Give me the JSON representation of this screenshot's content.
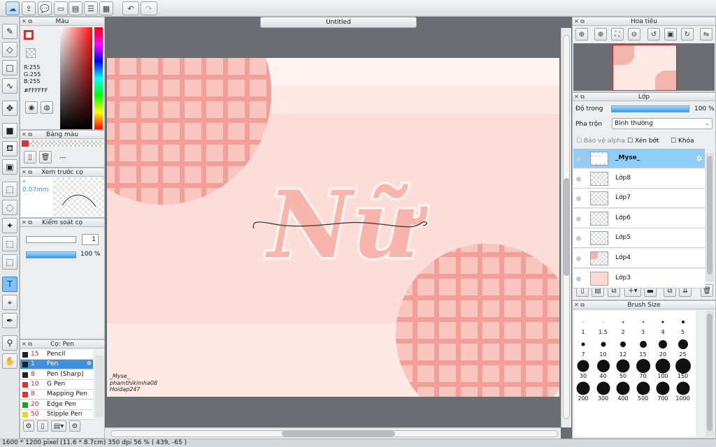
{
  "document": {
    "tab_title": "Untitled"
  },
  "panels": {
    "color": {
      "title": "Màu",
      "r": "R:255",
      "g": "G:255",
      "b": "B:255",
      "hex": "#FFFFFF"
    },
    "palette": {
      "title": "Bảng màu",
      "placeholder": "---"
    },
    "brush_preview": {
      "title": "Xem trước cọ",
      "size": "* 0.07mm"
    },
    "brush_control": {
      "title": "Kiểm soát cọ",
      "size_value": "1",
      "opacity": "100 %"
    },
    "brush_list": {
      "title": "Cọ: Pen",
      "items": [
        {
          "size": "15",
          "name": "Pencil",
          "color": "#222222"
        },
        {
          "size": "1",
          "name": "Pen",
          "color": "#222222"
        },
        {
          "size": "8",
          "name": "Pen (Sharp)",
          "color": "#222222"
        },
        {
          "size": "10",
          "name": "G Pen",
          "color": "#e23030"
        },
        {
          "size": "8",
          "name": "Mapping Pen",
          "color": "#e23030"
        },
        {
          "size": "20",
          "name": "Edge Pen",
          "color": "#22a022"
        },
        {
          "size": "50",
          "name": "Stipple Pen",
          "color": "#e8d820"
        }
      ]
    },
    "navigator": {
      "title": "Hoa tiêu"
    },
    "layers": {
      "title": "Lớp",
      "opacity_label": "Độ trong",
      "opacity_value": "100 %",
      "blend_label": "Pha trộn",
      "blend_value": "Bình thường",
      "protect_alpha": "Bảo vệ alpha",
      "clipping": "Xén bớt",
      "lock": "Khóa",
      "items": [
        {
          "name": "_Myse_",
          "selected": true
        },
        {
          "name": "Lớp8"
        },
        {
          "name": "Lớp7"
        },
        {
          "name": "Lớp6"
        },
        {
          "name": "Lớp5"
        },
        {
          "name": "Lớp4"
        },
        {
          "name": "Lớp3"
        }
      ]
    },
    "brush_size": {
      "title": "Brush Size",
      "sizes": [
        "1",
        "1.5",
        "2",
        "3",
        "4",
        "5",
        "7",
        "10",
        "12",
        "15",
        "20",
        "25",
        "30",
        "40",
        "50",
        "70",
        "100",
        "150",
        "200",
        "300",
        "400",
        "500",
        "700",
        "1000"
      ]
    }
  },
  "artwork": {
    "main_text": "Nữ",
    "signature_lines": [
      "_Myse_",
      "phamthikimha08",
      "Hoidap247"
    ]
  },
  "status_bar": {
    "text": "1600 * 1200 pixel   (11.6 * 8.7cm)   350 dpi   56 %   ( 439, -65 )"
  },
  "colors": {
    "accent": "#3d8fe0",
    "canvas_bg": "#fde8e4",
    "grid_pink": "#f39e98"
  }
}
